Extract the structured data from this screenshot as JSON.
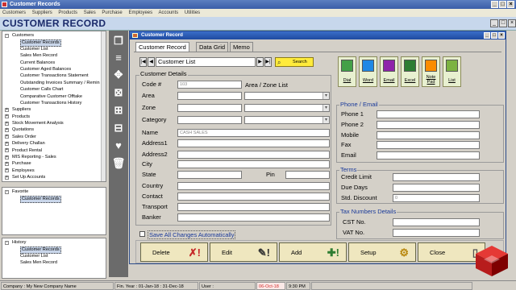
{
  "window": {
    "title": "Customer Records"
  },
  "menu": [
    "Customers",
    "Suppliers",
    "Products",
    "Sales",
    "Purchase",
    "Employees",
    "Accounts",
    "Utilities"
  ],
  "header": {
    "title": "CUSTOMER RECORD"
  },
  "tree": {
    "items": [
      {
        "label": "Customers",
        "expander": "-",
        "level": 0
      },
      {
        "label": "Customer Records",
        "level": 1,
        "selected": true
      },
      {
        "label": "Customer List",
        "level": 1
      },
      {
        "label": "Sales Men Record",
        "level": 1
      },
      {
        "label": "Current Balances",
        "level": 1
      },
      {
        "label": "Customer Aged Balances",
        "level": 1
      },
      {
        "label": "Customer Transactions Statement",
        "level": 1
      },
      {
        "label": "Outstanding Invoices Summary / Remin",
        "level": 1
      },
      {
        "label": "Customer Calls Chart",
        "level": 1
      },
      {
        "label": "Comparative Customer Offtake",
        "level": 1
      },
      {
        "label": "Customer Transactions History",
        "level": 1
      },
      {
        "label": "Suppliers",
        "expander": "+",
        "level": 0
      },
      {
        "label": "Products",
        "expander": "+",
        "level": 0
      },
      {
        "label": "Stock Movement Analysis",
        "expander": "+",
        "level": 0
      },
      {
        "label": "Quotations",
        "expander": "+",
        "level": 0
      },
      {
        "label": "Sales Order",
        "expander": "+",
        "level": 0
      },
      {
        "label": "Delivery Challan",
        "expander": "+",
        "level": 0
      },
      {
        "label": "Product Rental",
        "expander": "+",
        "level": 0
      },
      {
        "label": "MIS Reporting - Sales",
        "expander": "+",
        "level": 0
      },
      {
        "label": "Purchase",
        "expander": "+",
        "level": 0
      },
      {
        "label": "Employees",
        "expander": "+",
        "level": 0
      },
      {
        "label": "Set Up Accounts",
        "expander": "+",
        "level": 0
      }
    ]
  },
  "favorite": {
    "items": [
      {
        "label": "Favorite",
        "expander": "-",
        "level": 0
      },
      {
        "label": "Customer Records",
        "level": 1,
        "selected": true
      }
    ]
  },
  "history": {
    "items": [
      {
        "label": "History",
        "expander": "-",
        "level": 0
      },
      {
        "label": "Customer Records",
        "level": 1,
        "selected": true
      },
      {
        "label": "Customer List",
        "level": 1
      },
      {
        "label": "Sales Men Record",
        "level": 1
      }
    ]
  },
  "form": {
    "title": "Customer Record",
    "tabs": [
      "Customer Record",
      "Data Grid",
      "Memo"
    ],
    "nav": {
      "first": "|◀",
      "prev": "◀",
      "list_value": "Customer List",
      "next": "▶",
      "last": "▶|",
      "search_label": "Search"
    },
    "actions": [
      {
        "label": "Dial",
        "color": "#2e7d32"
      },
      {
        "label": "Word",
        "color": "#1565c0"
      },
      {
        "label": "Email",
        "color": "#6a1b9a"
      },
      {
        "label": "Excel",
        "color": "#2e7d32"
      },
      {
        "label": "Note Pad",
        "color": "#ef6c00"
      },
      {
        "label": "List",
        "color": "#558b2f"
      }
    ],
    "details": {
      "group_title": "Customer Details",
      "code_label": "Code #",
      "code_value": "103",
      "area_zone_list_label": "Area / Zone List",
      "area_label": "Area",
      "zone_label": "Zone",
      "category_label": "Category",
      "name_label": "Name",
      "name_value": "CASH SALES",
      "address1_label": "Address1",
      "address2_label": "Address2",
      "city_label": "City",
      "state_label": "State",
      "pin_label": "Pin",
      "country_label": "Country",
      "contact_label": "Contact",
      "transport_label": "Transport",
      "banker_label": "Banker"
    },
    "phone": {
      "group_title": "Phone / Email",
      "phone1_label": "Phone 1",
      "phone2_label": "Phone 2",
      "mobile_label": "Mobile",
      "fax_label": "Fax",
      "email_label": "Email"
    },
    "terms": {
      "group_title": "Terms",
      "credit_limit_label": "Credit Limit",
      "due_days_label": "Due Days",
      "std_discount_label": "Std. Discount",
      "std_discount_value": "0"
    },
    "tax": {
      "group_title": "Tax Numbers Details",
      "cst_label": "CST No.",
      "vat_label": "VAT No."
    },
    "save_auto_label": "Save All Changes Automatically",
    "buttons": {
      "delete": "Delete",
      "edit": "Edit",
      "add": "Add",
      "setup": "Setup",
      "close": "Close"
    }
  },
  "status": {
    "company": "Company : My New Company Name",
    "fin_year": "Fin. Year : 01-Jan-18 : 31-Dec-18",
    "user": "User :",
    "date": "06-Oct-18",
    "time": "9:30 PM"
  },
  "colors": {
    "title_blue": "#1f4aa0",
    "action_bg": "#e8f0d0",
    "button_bg": "#efe7bf",
    "date_red": "#d32f2f"
  }
}
